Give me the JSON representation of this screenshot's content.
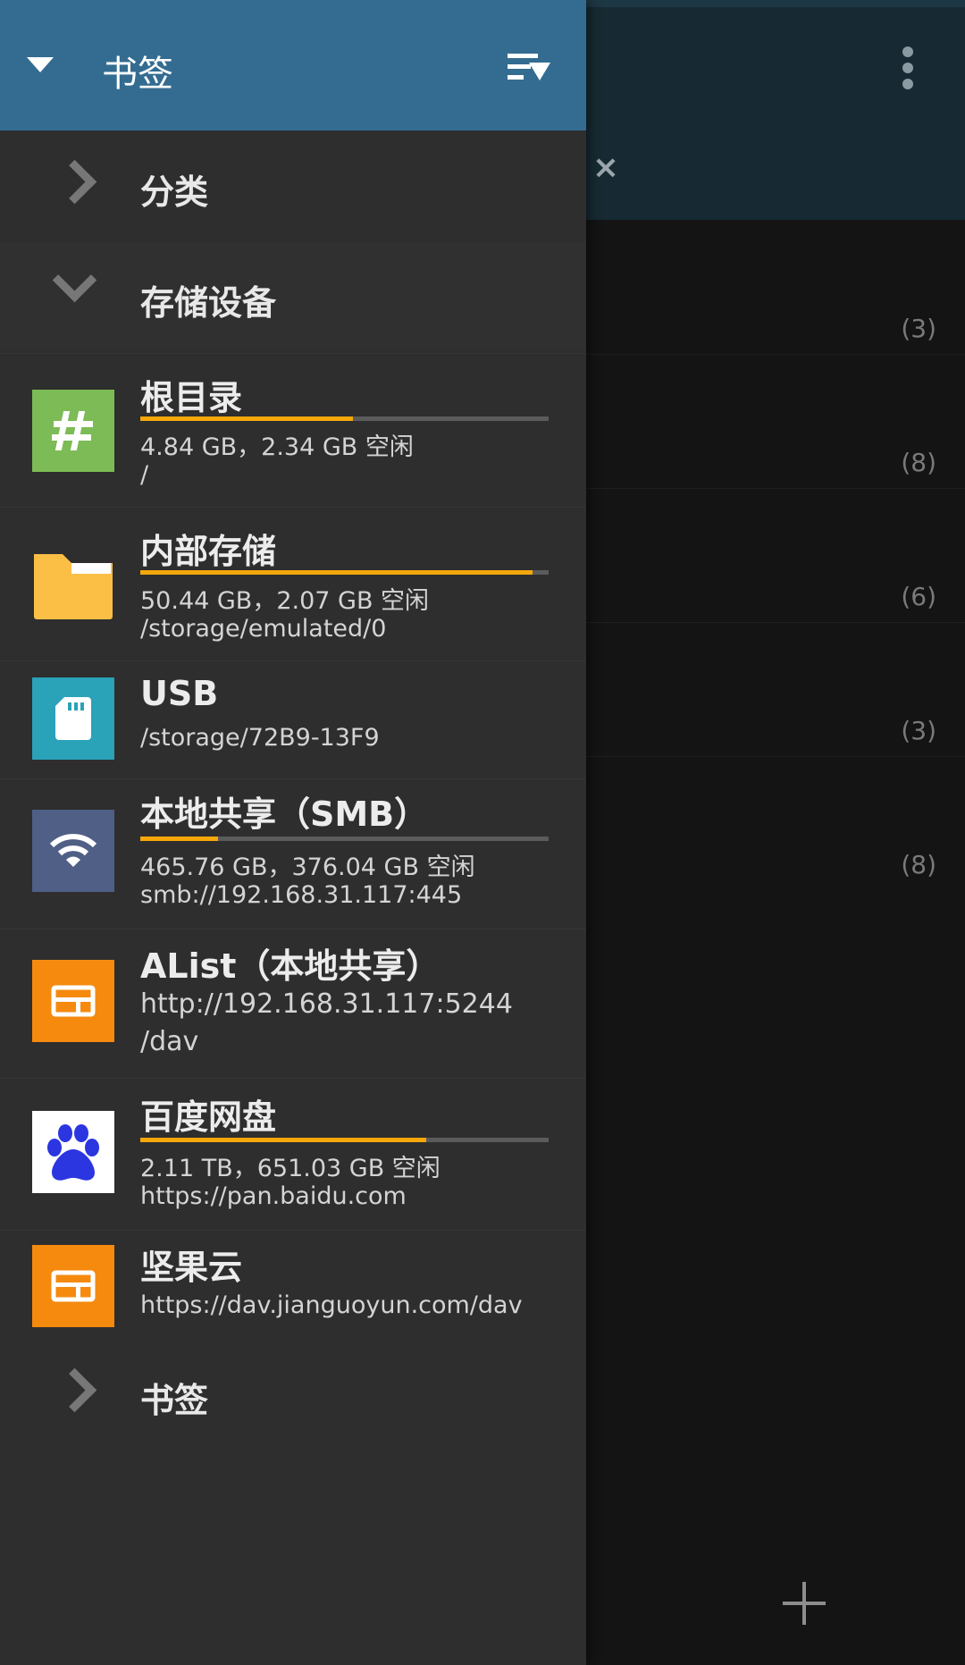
{
  "drawer": {
    "title": "书签",
    "sections": {
      "categories": "分类",
      "storage": "存储设备",
      "bookmarks": "书签"
    },
    "devices": [
      {
        "name": "根目录",
        "size": "4.84 GB，2.34 GB 空闲",
        "path": "/",
        "usage": 0.52,
        "icon": "hash-icon",
        "color": "#7cbb55"
      },
      {
        "name": "内部存储",
        "size": "50.44 GB，2.07 GB 空闲",
        "path": "/storage/emulated/0",
        "usage": 0.96,
        "icon": "folder-icon",
        "color": "#fbbf45"
      },
      {
        "name": "USB",
        "path": "/storage/72B9-13F9",
        "icon": "sd-card-icon",
        "color": "#2aa2b8"
      },
      {
        "name": "本地共享（SMB）",
        "size": "465.76 GB，376.04 GB 空闲",
        "path": "smb://192.168.31.117:445",
        "usage": 0.19,
        "icon": "wifi-icon",
        "color": "#4f5f85"
      },
      {
        "name": "AList（本地共享）",
        "url": "http://192.168.31.117:5244",
        "path": "/dav",
        "icon": "webdav-icon",
        "color": "#f58a0f"
      },
      {
        "name": "百度网盘",
        "size": "2.11 TB，651.03 GB 空闲",
        "path": "https://pan.baidu.com",
        "usage": 0.7,
        "icon": "baidu-paw-icon",
        "color": "#ffffff"
      },
      {
        "name": "坚果云",
        "path": "https://dav.jianguoyun.com/dav",
        "icon": "webdav-icon",
        "color": "#f58a0f"
      }
    ]
  },
  "background": {
    "counts": [
      "(3)",
      "(8)",
      "(6)",
      "(3)",
      "(8)"
    ]
  },
  "colors": {
    "header": "#346c91",
    "drawer_bg": "#2e2e2e",
    "progress": "#f6a70a",
    "bg_header": "#172a33"
  }
}
